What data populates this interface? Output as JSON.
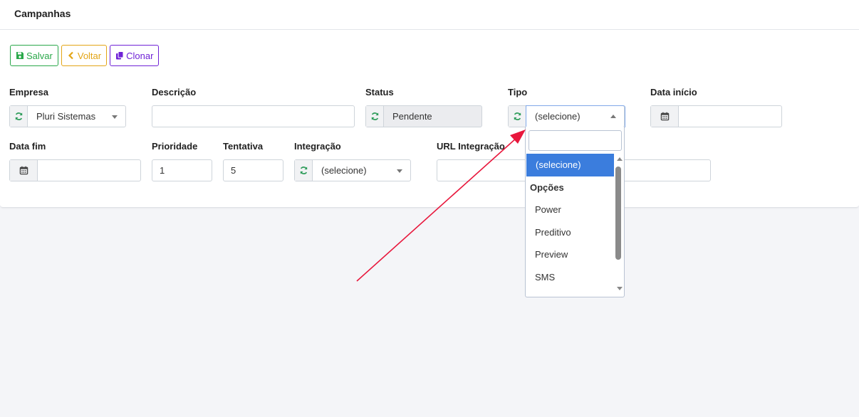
{
  "header": {
    "title": "Campanhas"
  },
  "toolbar": {
    "save_label": "Salvar",
    "back_label": "Voltar",
    "clone_label": "Clonar"
  },
  "form": {
    "empresa": {
      "label": "Empresa",
      "value": "Pluri Sistemas"
    },
    "descricao": {
      "label": "Descrição",
      "value": ""
    },
    "status": {
      "label": "Status",
      "value": "Pendente"
    },
    "tipo": {
      "label": "Tipo",
      "value": "(selecione)"
    },
    "data_inicio": {
      "label": "Data início",
      "value": ""
    },
    "data_fim": {
      "label": "Data fim",
      "value": ""
    },
    "prioridade": {
      "label": "Prioridade",
      "value": "1"
    },
    "tentativa": {
      "label": "Tentativa",
      "value": "5"
    },
    "integracao": {
      "label": "Integração",
      "value": "(selecione)"
    },
    "url_integracao": {
      "label": "URL Integração",
      "value": ""
    }
  },
  "tipo_dropdown": {
    "search_value": "",
    "selected": "(selecione)",
    "group_label": "Opções",
    "options": [
      "Power",
      "Preditivo",
      "Preview",
      "SMS"
    ]
  },
  "colors": {
    "save": "#2aa84a",
    "back": "#e3a516",
    "clone": "#6f22d6",
    "selected_option": "#3b7ddd",
    "annotation_arrow": "#e8173c"
  },
  "icons": [
    "save-icon",
    "chevron-left-icon",
    "copy-icon",
    "refresh-icon",
    "calendar-icon",
    "caret-down-icon",
    "caret-up-icon"
  ]
}
